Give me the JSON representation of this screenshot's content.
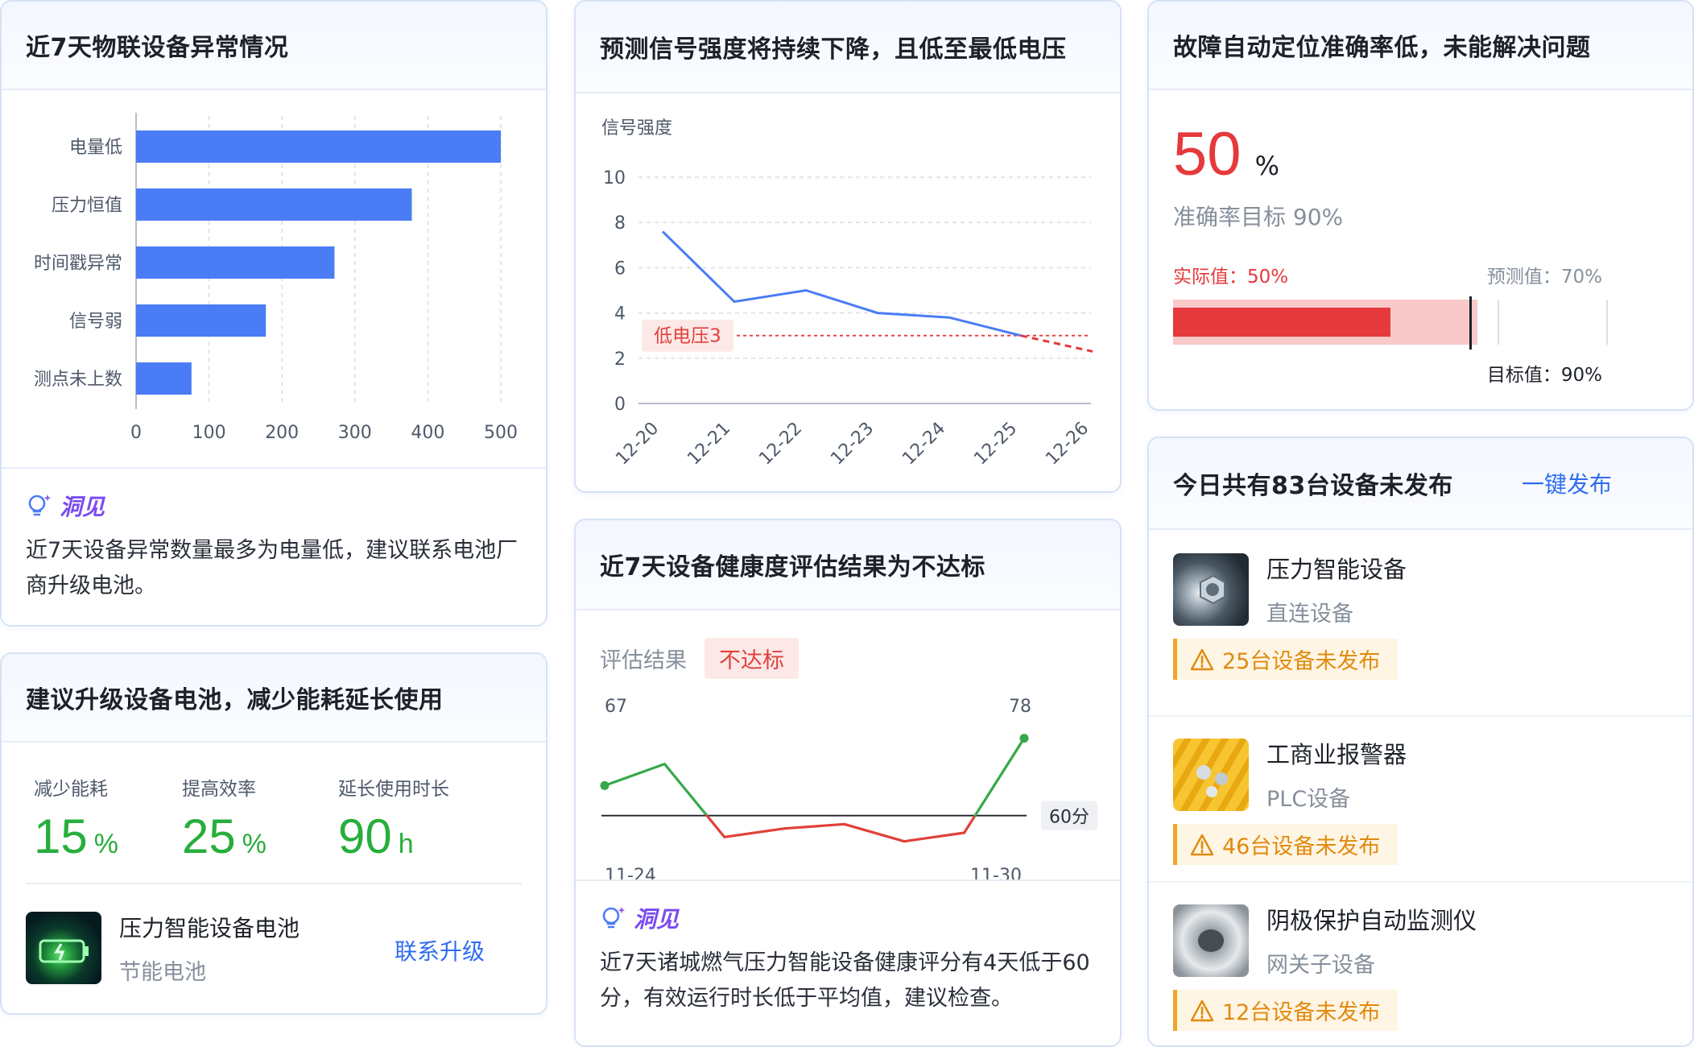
{
  "anomaly_card": {
    "title": "近7天物联设备异常情况",
    "insight_label": "洞见",
    "insight_text": "近7天设备异常数量最多为电量低，建议联系电池厂商升级电池。"
  },
  "signal_card": {
    "title": "预测信号强度将持续下降，且低至最低电压",
    "threshold_label": "低电压3"
  },
  "accuracy_card": {
    "title": "故障自动定位准确率低，未能解决问题",
    "value": "50",
    "unit": "%",
    "target_text": "准确率目标 90%",
    "actual_label": "实际值：50%",
    "predicted_label": "预测值：70%",
    "target_label": "目标值：90%",
    "actual_fraction": 0.5,
    "predicted_fraction": 0.7,
    "target_fraction": 0.9,
    "colors": {
      "actual": "#e5393b",
      "predicted": "#f9c9c9"
    }
  },
  "upgrade_card": {
    "title": "建议升级设备电池，减少能耗延长使用",
    "metrics": [
      {
        "label": "减少能耗",
        "value": "15",
        "unit": "%"
      },
      {
        "label": "提高效率",
        "value": "25",
        "unit": "%"
      },
      {
        "label": "延长使用时长",
        "value": "90",
        "unit": "h"
      }
    ],
    "product_name": "压力智能设备电池",
    "product_sub": "节能电池",
    "action": "联系升级"
  },
  "health_card": {
    "title": "近7天设备健康度评估结果为不达标",
    "result_label": "评估结果",
    "result_value": "不达标",
    "start_value_label": "67",
    "end_value_label": "78",
    "start_date": "11-24",
    "end_date": "11-30",
    "threshold_label": "60分",
    "insight_label": "洞见",
    "insight_text": "近7天诸城燃气压力智能设备健康评分有4天低于60分，有效运行时长低于平均值，建议检查。"
  },
  "publish_card": {
    "title": "今日共有83台设备未发布",
    "action": "一键发布",
    "devices": [
      {
        "name": "压力智能设备",
        "type": "直连设备",
        "warning": "25台设备未发布"
      },
      {
        "name": "工商业报警器",
        "type": "PLC设备",
        "warning": "46台设备未发布"
      },
      {
        "name": "阴极保护自动监测仪",
        "type": "网关子设备",
        "warning": "12台设备未发布"
      }
    ]
  },
  "chart_data": [
    {
      "type": "bar",
      "orientation": "horizontal",
      "categories": [
        "电量低",
        "压力恒值",
        "时间戳异常",
        "信号弱",
        "测点未上数"
      ],
      "values": [
        500,
        378,
        272,
        178,
        76
      ],
      "xlim": [
        0,
        500
      ],
      "xticks": [
        0,
        100,
        200,
        300,
        400,
        500
      ],
      "grid": true,
      "color": "#4a7cf5"
    },
    {
      "type": "line",
      "ylabel": "信号强度",
      "categories": [
        "12-20",
        "12-21",
        "12-22",
        "12-23",
        "12-24",
        "12-25",
        "12-26"
      ],
      "series": [
        {
          "values": [
            7.6,
            4.5,
            5.0,
            4.0,
            3.8,
            3.0,
            null
          ],
          "style": "solid"
        },
        {
          "values": [
            null,
            null,
            null,
            null,
            null,
            3.0,
            2.3
          ],
          "style": "dashed"
        }
      ],
      "threshold": 3,
      "ylim": [
        0,
        10
      ],
      "yticks": [
        0,
        2,
        4,
        6,
        8,
        10
      ],
      "grid": true,
      "colors": {
        "line": "#4a7cf5",
        "forecast": "#e5393b",
        "threshold": "#e5393b"
      }
    },
    {
      "type": "line",
      "series": [
        {
          "values": [
            67,
            72,
            55,
            57,
            58,
            54,
            56,
            78
          ]
        }
      ],
      "threshold": 60,
      "ylim": [
        50,
        80
      ],
      "colors": {
        "above": "#36a84a",
        "below": "#e0413a",
        "threshold": "#1d2129"
      }
    }
  ]
}
